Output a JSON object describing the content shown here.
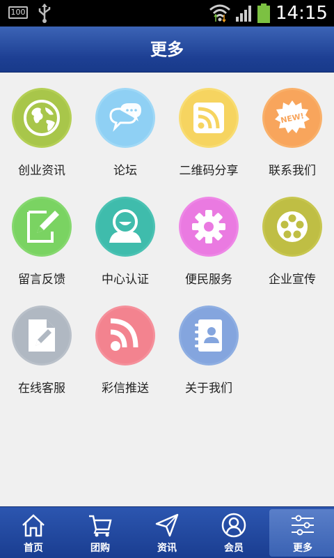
{
  "status_bar": {
    "battery_small_text": "100",
    "time": "14:15",
    "battery_color": "#7cc142"
  },
  "header": {
    "title": "更多"
  },
  "grid": {
    "items": [
      {
        "label": "创业资讯",
        "icon": "globe-icon",
        "color": "#b4cf55"
      },
      {
        "label": "论坛",
        "icon": "chat-bubbles-icon",
        "color": "#9fd8f6"
      },
      {
        "label": "二维码分享",
        "icon": "rss-square-icon",
        "color": "#f8dc72"
      },
      {
        "label": "联系我们",
        "icon": "new-badge-icon",
        "color": "#f9b06a",
        "badge_text": "NEW!"
      },
      {
        "label": "留言反馈",
        "icon": "edit-note-icon",
        "color": "#86d86f"
      },
      {
        "label": "中心认证",
        "icon": "user-icon",
        "color": "#4bc2b3"
      },
      {
        "label": "便民服务",
        "icon": "gear-icon",
        "color": "#ee87e6"
      },
      {
        "label": "企业宣传",
        "icon": "film-reel-icon",
        "color": "#c7c64f"
      },
      {
        "label": "在线客服",
        "icon": "document-edit-icon",
        "color": "#b9c0c9"
      },
      {
        "label": "彩信推送",
        "icon": "rss-icon",
        "color": "#f5909b"
      },
      {
        "label": "关于我们",
        "icon": "contacts-book-icon",
        "color": "#8eaee2"
      }
    ]
  },
  "bottom_nav": {
    "items": [
      {
        "label": "首页",
        "icon": "home-icon"
      },
      {
        "label": "团购",
        "icon": "cart-icon"
      },
      {
        "label": "资讯",
        "icon": "paper-plane-icon"
      },
      {
        "label": "会员",
        "icon": "member-icon"
      },
      {
        "label": "更多",
        "icon": "sliders-icon",
        "active": true
      }
    ]
  }
}
